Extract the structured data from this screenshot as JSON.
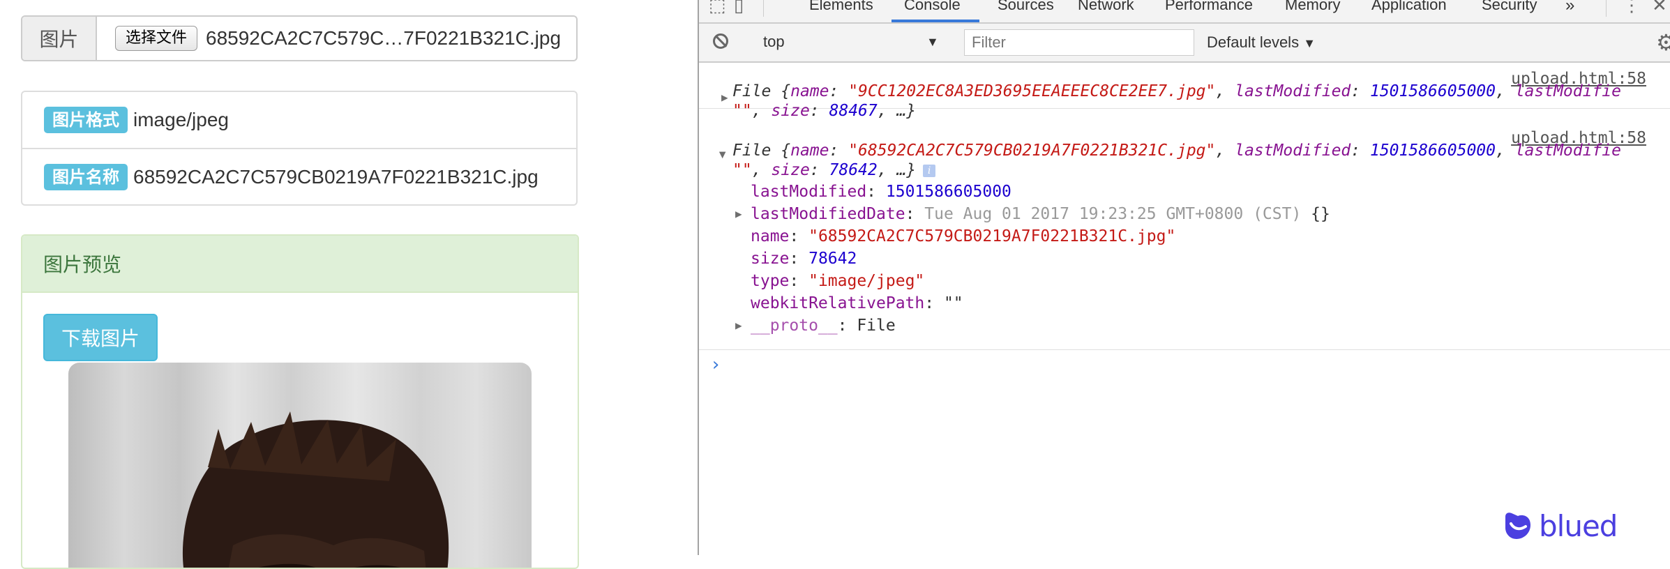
{
  "page": {
    "file_label": "图片",
    "file_button": "选择文件",
    "file_name": "68592CA2C7C579C…7F0221B321C.jpg",
    "info": [
      {
        "badge": "图片格式",
        "value": "image/jpeg"
      },
      {
        "badge": "图片名称",
        "value": "68592CA2C7C579CB0219A7F0221B321C.jpg"
      }
    ],
    "panel_title": "图片预览",
    "download_label": "下载图片"
  },
  "devtools": {
    "tabs": [
      "Elements",
      "Console",
      "Sources",
      "Network",
      "Performance",
      "Memory",
      "Application",
      "Security"
    ],
    "more_tabs": "»",
    "context": "top",
    "filter_placeholder": "Filter",
    "levels": "Default levels",
    "messages": [
      {
        "source": "upload.html:58",
        "head1_a": "File {",
        "head1_name_key": "name",
        "head1_name_val": "\"9CC1202EC8A3ED3695EEAEEEC8CE2EE7.jpg\"",
        "head1_lm_key": "lastModified",
        "head1_lm_val": "1501586605000",
        "head1_tail": "lastModifie",
        "head2_str": "\"\"",
        "head2_size_key": "size",
        "head2_size_val": "88467",
        "head2_end": ", …}"
      },
      {
        "source": "upload.html:58",
        "head1_a": "File {",
        "head1_name_key": "name",
        "head1_name_val": "\"68592CA2C7C579CB0219A7F0221B321C.jpg\"",
        "head1_lm_key": "lastModified",
        "head1_lm_val": "1501586605000",
        "head1_tail": "lastModifie",
        "head2_str": "\"\"",
        "head2_size_key": "size",
        "head2_size_val": "78642",
        "head2_end": ", …}",
        "info_badge": "i",
        "props": [
          {
            "key": "lastModified",
            "value": "1501586605000",
            "kind": "number"
          },
          {
            "key": "lastModifiedDate",
            "value": "Tue Aug 01 2017 19:23:25 GMT+0800 (CST)",
            "extra": "{}",
            "kind": "date",
            "expandable": true
          },
          {
            "key": "name",
            "value": "\"68592CA2C7C579CB0219A7F0221B321C.jpg\"",
            "kind": "string"
          },
          {
            "key": "size",
            "value": "78642",
            "kind": "number"
          },
          {
            "key": "type",
            "value": "\"image/jpeg\"",
            "kind": "string"
          },
          {
            "key": "webkitRelativePath",
            "value": "\"\"",
            "kind": "plain"
          },
          {
            "key": "__proto__",
            "value": "File",
            "kind": "proto",
            "expandable": true
          }
        ]
      }
    ],
    "prompt": "›"
  },
  "brand": {
    "name": "blued",
    "color": "#4b3fe0"
  }
}
